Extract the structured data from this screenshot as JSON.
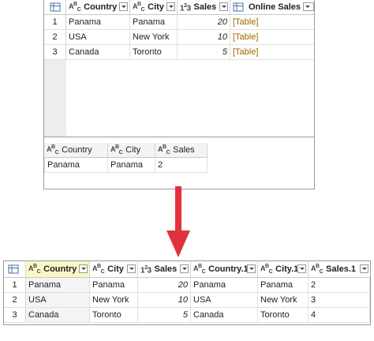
{
  "top_table": {
    "headers": [
      {
        "type": "ABC",
        "label": "Country"
      },
      {
        "type": "ABC",
        "label": "City"
      },
      {
        "type": "123",
        "label": "Sales"
      },
      {
        "type": "table",
        "label": "Online Sales"
      }
    ],
    "rows": [
      {
        "num": "1",
        "country": "Panama",
        "city": "Panama",
        "sales": "20",
        "online": "[Table]"
      },
      {
        "num": "2",
        "country": "USA",
        "city": "New York",
        "sales": "10",
        "online": "[Table]"
      },
      {
        "num": "3",
        "country": "Canada",
        "city": "Toronto",
        "sales": "5",
        "online": "[Table]"
      }
    ]
  },
  "preview_table": {
    "headers": [
      {
        "type": "ABC",
        "label": "Country"
      },
      {
        "type": "ABC",
        "label": "City"
      },
      {
        "type": "ABC",
        "label": "Sales"
      }
    ],
    "row": {
      "country": "Panama",
      "city": "Panama",
      "sales": "2"
    }
  },
  "result_table": {
    "headers": [
      {
        "type": "ABC",
        "label": "Country"
      },
      {
        "type": "ABC",
        "label": "City"
      },
      {
        "type": "123",
        "label": "Sales"
      },
      {
        "type": "ABC",
        "label": "Country.1"
      },
      {
        "type": "ABC",
        "label": "City.1"
      },
      {
        "type": "ABC",
        "label": "Sales.1"
      }
    ],
    "rows": [
      {
        "num": "1",
        "country": "Panama",
        "city": "Panama",
        "sales": "20",
        "country1": "Panama",
        "city1": "Panama",
        "sales1": "2"
      },
      {
        "num": "2",
        "country": "USA",
        "city": "New York",
        "sales": "10",
        "country1": "USA",
        "city1": "New York",
        "sales1": "3"
      },
      {
        "num": "3",
        "country": "Canada",
        "city": "Toronto",
        "sales": "5",
        "country1": "Canada",
        "city1": "Toronto",
        "sales1": "4"
      }
    ]
  },
  "colors": {
    "arrow": "#e0323c",
    "selected_header": "#fbf6c6",
    "table_link": "#9a6a00"
  }
}
